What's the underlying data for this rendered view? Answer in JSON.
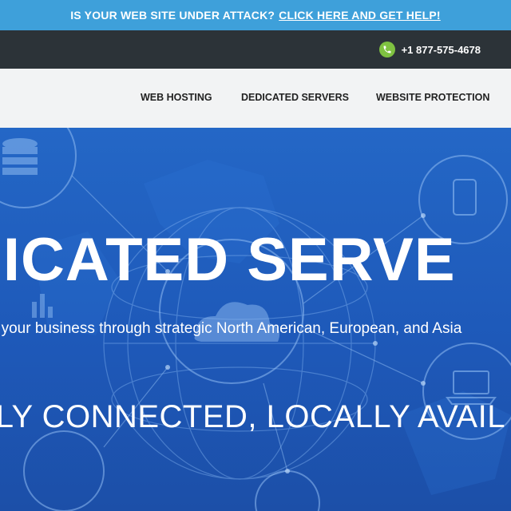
{
  "topbar": {
    "alert_text": "IS YOUR WEB SITE UNDER ATTACK?",
    "alert_link": "CLICK HERE AND GET HELP!",
    "background_color": "#3ea0da"
  },
  "contact": {
    "phone": "+1 877-575-4678",
    "phone_icon": "phone-icon",
    "icon_color": "#7fc241"
  },
  "nav": {
    "items": [
      {
        "label": "WEB HOSTING"
      },
      {
        "label": "DEDICATED SERVERS"
      },
      {
        "label": "WEBSITE PROTECTION"
      }
    ]
  },
  "hero": {
    "title": "DICATED SERVE",
    "subtitle": "r your business through strategic North American, European, and Asia",
    "tagline": "LLY CONNECTED, LOCALLY AVAIL",
    "background_color": "#1f57b5"
  }
}
